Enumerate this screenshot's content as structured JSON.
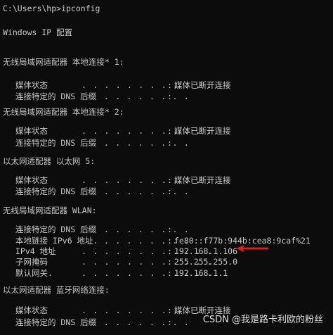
{
  "prompt_line": "C:\\Users\\hp>ipconfig",
  "win_ip_config_title": "Windows IP 配置",
  "colon": ":",
  "adapters": [
    {
      "header": "无线局域网适配器 本地连接* 1:",
      "rows": [
        {
          "label": "媒体状态",
          "dots": ". . . . . . . . . . . .",
          "value": "媒体已断开连接"
        },
        {
          "label": "连接特定的 DNS 后缀",
          "dots": ". . . . . . . .",
          "value": ""
        }
      ]
    },
    {
      "header": "无线局域网适配器 本地连接* 2:",
      "rows": [
        {
          "label": "媒体状态",
          "dots": ". . . . . . . . . . . .",
          "value": "媒体已断开连接"
        },
        {
          "label": "连接特定的 DNS 后缀",
          "dots": ". . . . . . . .",
          "value": ""
        }
      ]
    },
    {
      "header": "以太网适配器 以太网 5:",
      "rows": [
        {
          "label": "媒体状态",
          "dots": ". . . . . . . . . . . .",
          "value": "媒体已断开连接"
        },
        {
          "label": "连接特定的 DNS 后缀",
          "dots": ". . . . . . . .",
          "value": ""
        }
      ]
    },
    {
      "header": "无线局域网适配器 WLAN:",
      "rows": [
        {
          "label": "连接特定的 DNS 后缀",
          "dots": ". . . . . . . .",
          "value": ""
        },
        {
          "label": "本地链接 IPv6 地址.",
          "dots": ". . . . . . . .",
          "value": "fe80::f77b:944b:cea8:9caf%21"
        },
        {
          "label": "IPv4 地址",
          "dots": ". . . . . . . . . . . .",
          "value": "192.168.1.106"
        },
        {
          "label": "子网掩码",
          "dots": ". . . . . . . . . . . .",
          "value": "255.255.255.0"
        },
        {
          "label": "默认网关.",
          "dots": ". . . . . . . . . . . .",
          "value": "192.168.1.1"
        }
      ]
    },
    {
      "header": "以太网适配器 蓝牙网络连接:",
      "rows": [
        {
          "label": "媒体状态",
          "dots": ". . . . . . . . . . . .",
          "value": "媒体已断开连接"
        },
        {
          "label": "连接特定的 DNS 后缀",
          "dots": ". . . . . . . .",
          "value": ""
        }
      ]
    }
  ],
  "watermark": "CSDN @我是路卡利欧的粉丝",
  "colors": {
    "background": "#0c0c0c",
    "text": "#cccccc",
    "annotation_arrow": "#e0201c"
  }
}
